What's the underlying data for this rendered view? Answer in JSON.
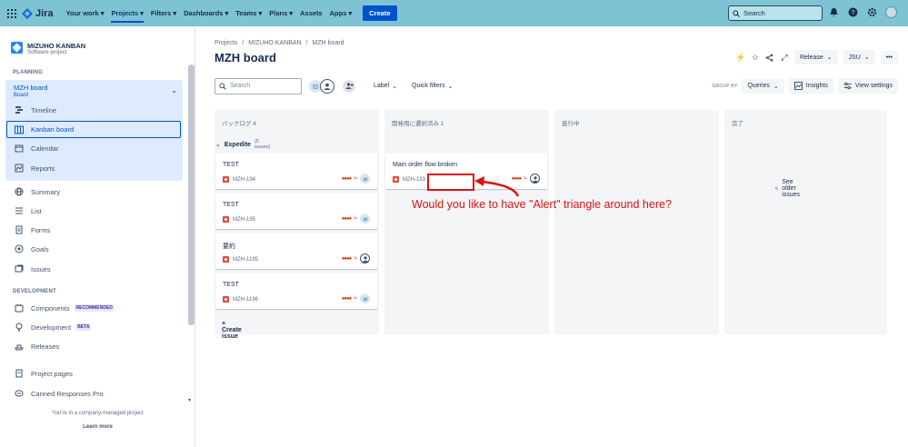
{
  "topbar": {
    "product": "Jira",
    "nav": [
      "Your work",
      "Projects",
      "Filters",
      "Dashboards",
      "Teams",
      "Plans",
      "Assets",
      "Apps"
    ],
    "create_label": "Create",
    "search_placeholder": "Search",
    "bg_color": "#7ec3d4"
  },
  "sidebar": {
    "project_name": "MIZUHO KANBAN",
    "project_type": "Software project",
    "planning_label": "PLANNING",
    "board_title": "MZH board",
    "board_sub": "Board",
    "planning_items": [
      "Timeline",
      "Kanban board",
      "Calendar",
      "Reports"
    ],
    "general_items": [
      "Summary",
      "List",
      "Forms",
      "Goals",
      "Issues"
    ],
    "development_label": "DEVELOPMENT",
    "dev_items": [
      {
        "label": "Components",
        "badge": "RECOMMENDED"
      },
      {
        "label": "Development",
        "badge": "BETA"
      },
      {
        "label": "Releases",
        "badge": ""
      }
    ],
    "extra_items": [
      "Project pages",
      "Canned Responses Pro"
    ],
    "footer_text": "You're in a company-managed project",
    "learn_more": "Learn more"
  },
  "main": {
    "breadcrumb": [
      "Projects",
      "MIZUHO KANBAN",
      "MZH board"
    ],
    "title": "MZH board",
    "release_label": "Release",
    "jsu_label": "JSU",
    "search_placeholder": "Search",
    "label_filter": "Label",
    "quick_filters": "Quick filters",
    "group_by": "GROUP BY",
    "queries": "Queries",
    "insights": "Insights",
    "view_settings": "View settings"
  },
  "board": {
    "columns": [
      "バックログ 4",
      "開発用に選択済み 1",
      "進行中",
      "完了"
    ],
    "swimlane": {
      "name": "Expedite",
      "count": "(5 issues)"
    },
    "backlog_cards": [
      {
        "title": "TEST",
        "key": "MZH-194",
        "assignee": "robot"
      },
      {
        "title": "TEST",
        "key": "MZH-195",
        "assignee": "robot"
      },
      {
        "title": "要約",
        "key": "MZH-1195",
        "assignee": "person"
      },
      {
        "title": "TEST",
        "key": "MZH-1196",
        "assignee": "robot"
      }
    ],
    "selected_cards": [
      {
        "title": "Main order flow broken",
        "key": "MZH-193",
        "assignee": "person"
      }
    ],
    "create_issue": "Create issue",
    "see_older": "See older issues"
  },
  "annotation": {
    "text": "Would you like to have \"Alert\" triangle around here?",
    "color": "#e01010"
  }
}
